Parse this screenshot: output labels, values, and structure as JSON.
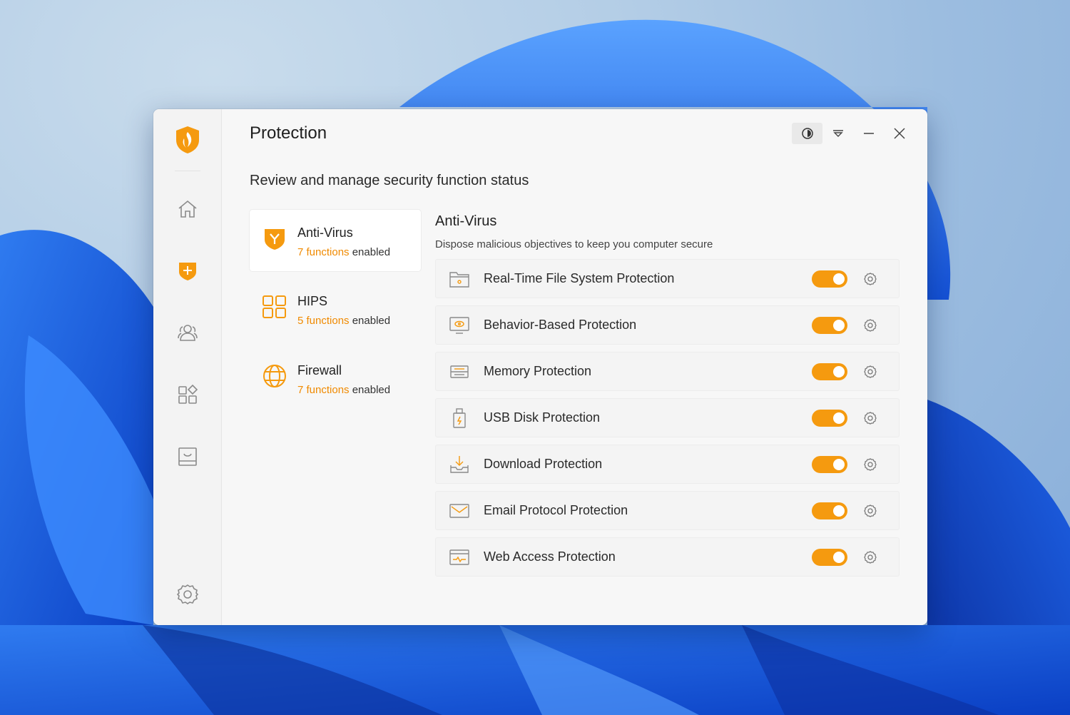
{
  "window": {
    "title": "Protection",
    "subtitle": "Review and manage security function status"
  },
  "sidebar": {
    "items": [
      {
        "name": "home",
        "icon": "home-icon"
      },
      {
        "name": "protection",
        "icon": "shield-plus-icon",
        "active": true
      },
      {
        "name": "users",
        "icon": "users-icon"
      },
      {
        "name": "apps",
        "icon": "apps-grid-icon"
      },
      {
        "name": "tray",
        "icon": "tray-icon"
      }
    ],
    "settings_icon": "gear-icon"
  },
  "window_controls": [
    "contrast-icon",
    "filter-icon",
    "minimize-icon",
    "close-icon"
  ],
  "categories": [
    {
      "name": "Anti-Virus",
      "count": "7 functions",
      "suffix": "enabled",
      "icon": "antivirus-shield-icon",
      "selected": true
    },
    {
      "name": "HIPS",
      "count": "5 functions",
      "suffix": "enabled",
      "icon": "hips-grid-icon",
      "selected": false
    },
    {
      "name": "Firewall",
      "count": "7 functions",
      "suffix": "enabled",
      "icon": "firewall-globe-icon",
      "selected": false
    }
  ],
  "detail": {
    "title": "Anti-Virus",
    "description": "Dispose malicious objectives to keep you computer secure",
    "functions": [
      {
        "label": "Real-Time File System Protection",
        "icon": "folder-icon",
        "enabled": true
      },
      {
        "label": "Behavior-Based Protection",
        "icon": "monitor-eye-icon",
        "enabled": true
      },
      {
        "label": "Memory Protection",
        "icon": "memory-icon",
        "enabled": true
      },
      {
        "label": "USB Disk Protection",
        "icon": "usb-icon",
        "enabled": true
      },
      {
        "label": "Download Protection",
        "icon": "download-icon",
        "enabled": true
      },
      {
        "label": "Email Protocol Protection",
        "icon": "email-icon",
        "enabled": true
      },
      {
        "label": "Web Access Protection",
        "icon": "web-icon",
        "enabled": true
      }
    ]
  },
  "colors": {
    "accent": "#f59a0f",
    "accent_text": "#f08a00",
    "window_bg": "#f7f7f7",
    "sidebar_bg": "#f3f3f3"
  }
}
